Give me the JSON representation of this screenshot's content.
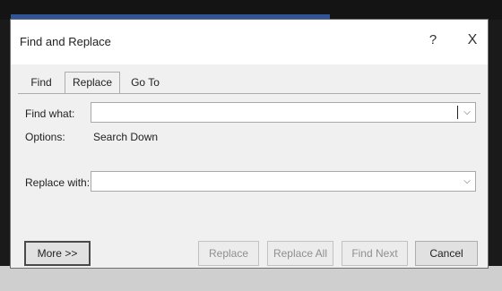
{
  "dialog": {
    "title": "Find and Replace",
    "help_label": "?",
    "close_label": "X"
  },
  "tabs": [
    {
      "label": "Find",
      "active": false
    },
    {
      "label": "Replace",
      "active": true
    },
    {
      "label": "Go To",
      "active": false
    }
  ],
  "find": {
    "label": "Find what:",
    "value": ""
  },
  "options": {
    "label": "Options:",
    "value": "Search Down"
  },
  "replace": {
    "label": "Replace with:",
    "value": ""
  },
  "icons": {
    "dropdown": "chevron-down-icon"
  },
  "buttons": {
    "more": "More >>",
    "replace": "Replace",
    "replace_all": "Replace All",
    "find_next": "Find Next",
    "cancel": "Cancel"
  },
  "colors": {
    "dialog_bg": "#f0f0f0",
    "titlebar_bg": "#ffffff",
    "accent": "#2f5597"
  }
}
